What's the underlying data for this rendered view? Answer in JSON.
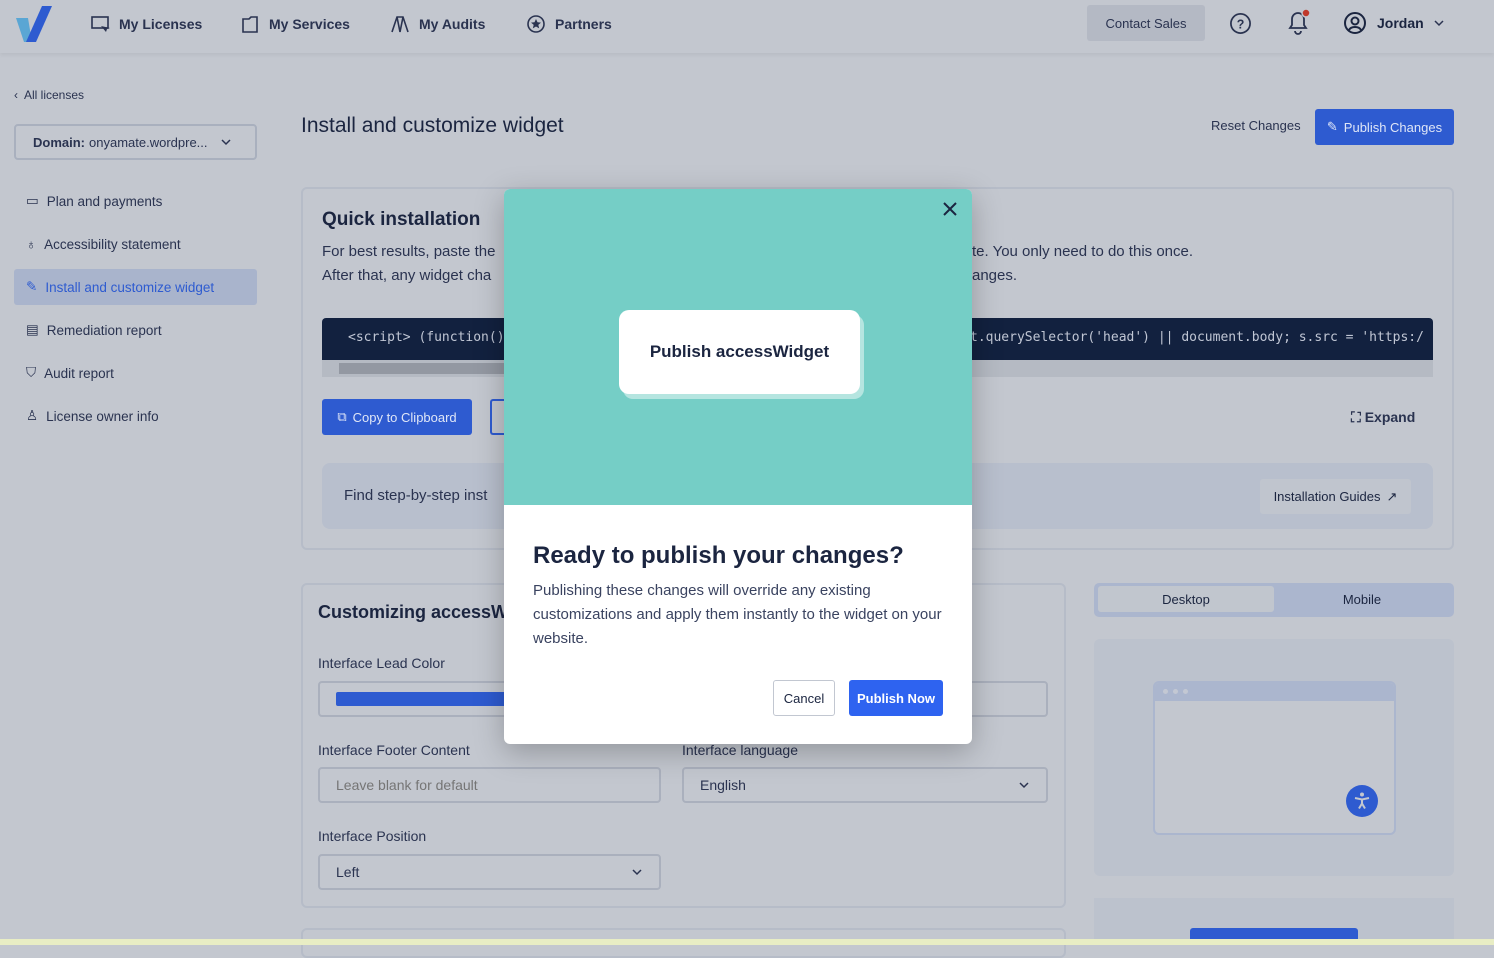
{
  "nav": {
    "items": [
      {
        "label": "My Licenses",
        "icon": "license-icon"
      },
      {
        "label": "My Services",
        "icon": "services-icon"
      },
      {
        "label": "My Audits",
        "icon": "audits-icon"
      },
      {
        "label": "Partners",
        "icon": "star-icon"
      }
    ],
    "contact_sales": "Contact Sales",
    "user": "Jordan"
  },
  "sidebar": {
    "back": "All licenses",
    "domain_label": "Domain:",
    "domain_value": "onyamate.wordpre...",
    "items": [
      {
        "label": "Plan and payments"
      },
      {
        "label": "Accessibility statement"
      },
      {
        "label": "Install and customize widget",
        "active": true
      },
      {
        "label": "Remediation report"
      },
      {
        "label": "Audit report"
      },
      {
        "label": "License owner info"
      }
    ]
  },
  "header": {
    "title": "Install and customize widget",
    "reset": "Reset Changes",
    "publish": "Publish Changes"
  },
  "quick": {
    "title": "Quick installation",
    "line1_a": "For best results, paste the",
    "line1_b": "te. You only need to do this once.",
    "line2_a": "After that, any widget cha",
    "line2_b": "anges.",
    "code_a": "<script> (function()",
    "code_b": "t.querySelector('head') || document.body; s.src = 'https:/",
    "copy": "Copy to Clipboard",
    "expand": "Expand",
    "find": "Find step-by-step inst",
    "guides": "Installation Guides"
  },
  "customize": {
    "title": "Customizing accessWi",
    "lead_color_label": "Interface Lead Color",
    "lead_color": "#2e5bd0",
    "footer_label": "Interface Footer Content",
    "footer_placeholder": "Leave blank for default",
    "language_label": "Interface language",
    "language": "English",
    "position_label": "Interface Position",
    "position": "Left"
  },
  "preview": {
    "tabs": [
      "Desktop",
      "Mobile"
    ],
    "active": "Desktop"
  },
  "modal": {
    "badge": "Publish accessWidget",
    "title": "Ready to publish your changes?",
    "body": "Publishing these changes will override any existing customizations and apply them instantly to the widget on your website.",
    "cancel": "Cancel",
    "confirm": "Publish Now"
  },
  "colors": {
    "accent": "#2e5bd0",
    "modal_hero": "#75cec6",
    "code_bg": "#12213f"
  }
}
